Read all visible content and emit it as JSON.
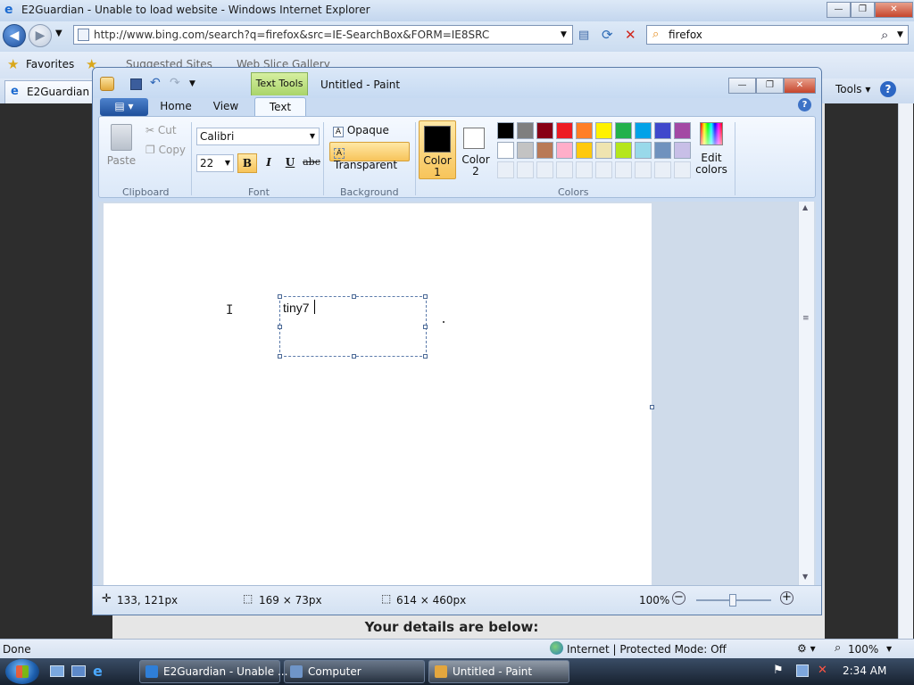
{
  "ie": {
    "title": "E2Guardian - Unable to load website - Windows Internet Explorer",
    "address": "http://www.bing.com/search?q=firefox&src=IE-SearchBox&FORM=IE8SRC",
    "search_value": "firefox",
    "favorites_label": "Favorites",
    "suggested_sites": "Suggested Sites",
    "web_slice": "Web Slice Gallery",
    "tab_label": "E2Guardian",
    "tools_label": "Tools",
    "page_heading": "Your details are below:",
    "status_text": "Done",
    "zone_text": "Internet | Protected Mode: Off",
    "zoom_text": "100%"
  },
  "taskbar": {
    "items": [
      "E2Guardian - Unable ...",
      "Computer",
      "Untitled - Paint"
    ],
    "clock": "2:34 AM"
  },
  "paint": {
    "title": "Untitled - Paint",
    "text_tools_label": "Text Tools",
    "tabs": [
      "Home",
      "View",
      "Text"
    ],
    "clipboard": {
      "paste": "Paste",
      "cut": "Cut",
      "copy": "Copy",
      "label": "Clipboard"
    },
    "font": {
      "name": "Calibri",
      "size": "22",
      "bold": "B",
      "italic": "I",
      "underline": "U",
      "strike": "abc",
      "label": "Font"
    },
    "background": {
      "opaque": "Opaque",
      "transparent": "Transparent",
      "label": "Background"
    },
    "colors": {
      "color1_label": "Color",
      "color1_num": "1",
      "color2_label": "Color",
      "color2_num": "2",
      "edit_line1": "Edit",
      "edit_line2": "colors",
      "label": "Colors",
      "color1": "#000000",
      "color2": "#ffffff",
      "row1": [
        "#000000",
        "#7f7f7f",
        "#880015",
        "#ed1c24",
        "#ff7f27",
        "#fff200",
        "#22b14c",
        "#00a2e8",
        "#3f48cc",
        "#a349a4"
      ],
      "row2": [
        "#ffffff",
        "#c3c3c3",
        "#b97a57",
        "#ffaec9",
        "#ffc90e",
        "#efe4b0",
        "#b5e61d",
        "#99d9ea",
        "#7092be",
        "#c8bfe7"
      ]
    },
    "canvas_text": "tiny7",
    "status": {
      "cursor_pos": "133, 121px",
      "selection_size": "169 × 73px",
      "canvas_size": "614 × 460px",
      "zoom": "100%"
    }
  }
}
